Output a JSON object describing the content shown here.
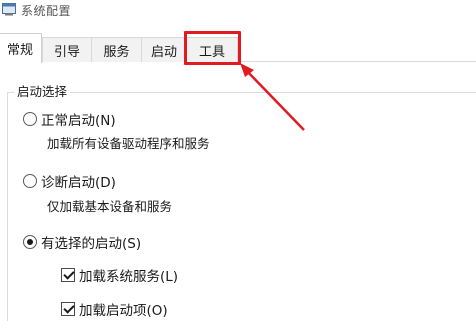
{
  "window": {
    "title": "系统配置",
    "icon": "msconfig-icon"
  },
  "tabs": [
    {
      "label": "常规",
      "active": true
    },
    {
      "label": "引导",
      "active": false
    },
    {
      "label": "服务",
      "active": false
    },
    {
      "label": "启动",
      "active": false
    },
    {
      "label": "工具",
      "active": false,
      "highlighted": true
    }
  ],
  "annotation": {
    "highlight_color": "#e11b22",
    "arrow_icon": "red-arrow-icon"
  },
  "startup_selection": {
    "title": "启动选择",
    "options": [
      {
        "label": "正常启动(N)",
        "description": "加载所有设备驱动程序和服务",
        "selected": false
      },
      {
        "label": "诊断启动(D)",
        "description": "仅加载基本设备和服务",
        "selected": false
      },
      {
        "label": "有选择的启动(S)",
        "selected": true
      }
    ],
    "selective_items": [
      {
        "label": "加载系统服务(L)",
        "checked": true
      },
      {
        "label": "加载启动项(O)",
        "checked": true
      }
    ]
  }
}
